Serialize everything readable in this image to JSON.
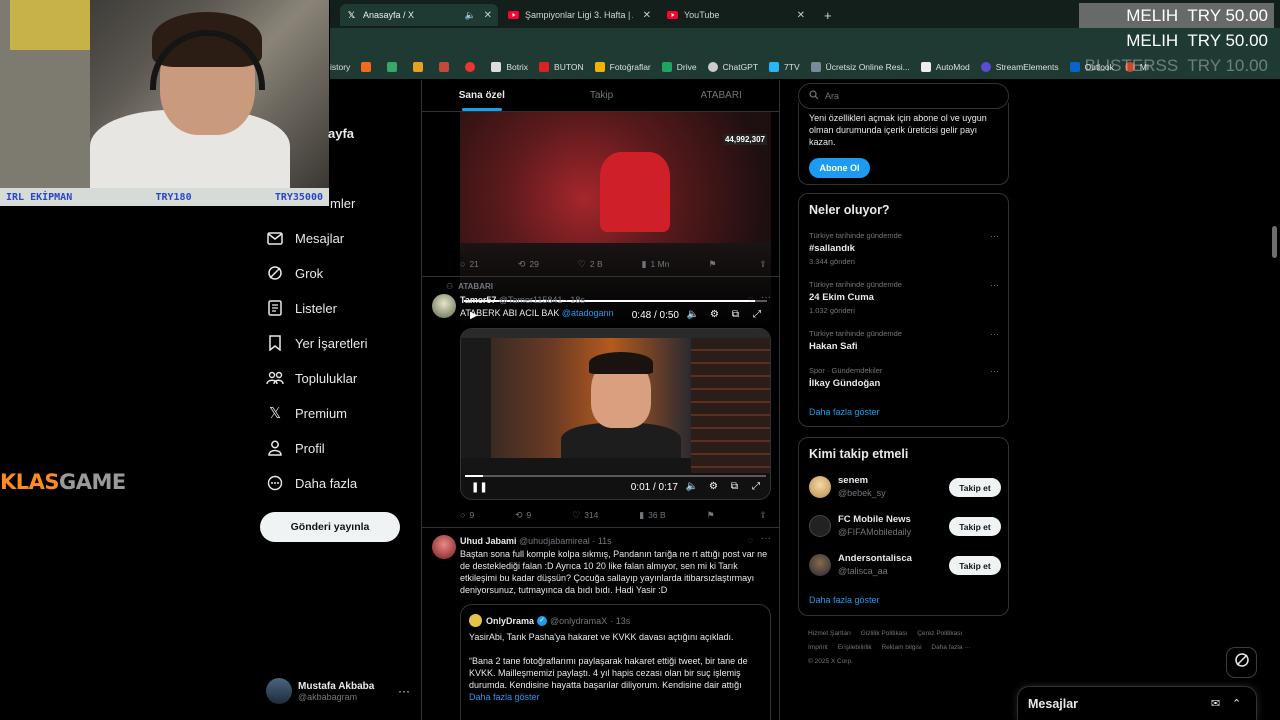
{
  "browser": {
    "tabs": [
      {
        "title": "Anasayfa / X",
        "active": true
      },
      {
        "title": "Şampiyonlar Ligi 3. Hafta | Arse",
        "active": false
      },
      {
        "title": "YouTube",
        "active": false
      }
    ],
    "bookmarks": [
      "istory",
      "",
      "",
      "",
      "",
      "Botrix",
      "BUTON",
      "Fotoğraflar",
      "Drive",
      "ChatGPT",
      "7TV",
      "Ücretsiz Online Resi...",
      "AutoMod",
      "StreamElements",
      "Outlook",
      "Mi"
    ]
  },
  "overlay": {
    "equipment": {
      "label": "IRL EKİPMAN",
      "price1": "TRY180",
      "price2": "TRY35000"
    },
    "donations": [
      {
        "name": "MELIH",
        "amount": "TRY 50.00"
      },
      {
        "name": "MELIH",
        "amount": "TRY 50.00"
      },
      {
        "name": "BLISTERSS",
        "amount": "TRY 10.00"
      }
    ],
    "logo": {
      "part1": "KLAS",
      "part2": "GAME"
    }
  },
  "nav": {
    "title_partial": "ayfa",
    "partial_item": "mler",
    "items": [
      "Mesajlar",
      "Grok",
      "Listeler",
      "Yer İşaretleri",
      "Topluluklar",
      "Premium",
      "Profil",
      "Daha fazla"
    ],
    "post_button": "Gönderi yayınla",
    "account": {
      "name": "Mustafa Akbaba",
      "handle": "@akbabagram"
    }
  },
  "feed": {
    "tabs": [
      "Sana özel",
      "Takip",
      "ATABARI"
    ],
    "video1": {
      "counter": "44,992,307",
      "time": "0:48 / 0:50",
      "progress": 0.96
    },
    "tweet1_actions": {
      "replies": "21",
      "reposts": "29",
      "likes": "2 B",
      "views": "1 Mn"
    },
    "tweet2": {
      "community": "ATABARI",
      "name": "Tamer57",
      "handle": "@Tamer115841",
      "time": "· 18s",
      "text": "ATABERK ABI ACIL BAK",
      "mention": "@atadogann",
      "video_time": "0:01 / 0:17",
      "video_progress": 0.06,
      "actions": {
        "replies": "9",
        "reposts": "9",
        "likes": "314",
        "views": "36 B"
      }
    },
    "tweet3": {
      "name": "Uhud Jabami",
      "handle": "@uhudjabamireal",
      "time": "· 11s",
      "text": "Baştan sona full komple kolpa sıkmış, Pandanın tarığa ne rt attığı post var ne de desteklediği falan :D Ayrıca 10 20 like falan almıyor, sen mi ki Tarık etkileşimi bu kadar düşsün? Çocuğa sallayıp yayınlarda itibarsızlaştırmayı deniyorsunuz, tutmayınca da bıdı bıdı. Hadi Yasir :D",
      "quote": {
        "name": "OnlyDrama",
        "handle": "@onlydramaX",
        "time": "· 13s",
        "line1": "YasirAbi, Tarık Pasha'ya hakaret ve KVKK davası açtığını açıkladı.",
        "line2": "“Bana 2 tane fotoğraflarımı paylaşarak hakaret ettiği tweet, bir tane de KVKK. Mailleşmemizi paylaştı. 4 yıl hapis cezası olan bir suç işlemiş durumda. Kendisine hayatta başarılar diliyorum. Kendisine dair attığı",
        "show_more": "Daha fazla göster"
      }
    }
  },
  "right": {
    "search_placeholder": "Ara",
    "premium": {
      "text": "Yeni özellikleri açmak için abone ol ve uygun olman durumunda içerik üreticisi gelir payı kazan.",
      "button": "Abone Ol"
    },
    "trends": {
      "title": "Neler oluyor?",
      "items": [
        {
          "context": "Türkiye tarihinde gündemde",
          "name": "#sallandık",
          "count": "3.344 gönderi"
        },
        {
          "context": "Türkiye tarihinde gündemde",
          "name": "24 Ekim Cuma",
          "count": "1.032 gönderi"
        },
        {
          "context": "Türkiye tarihinde gündemde",
          "name": "Hakan Safi",
          "count": ""
        },
        {
          "context": "Spor · Gündemdekiler",
          "name": "İlkay Gündoğan",
          "count": ""
        }
      ],
      "show_more": "Daha fazla göster"
    },
    "who_to_follow": {
      "title": "Kimi takip etmeli",
      "items": [
        {
          "name": "senem",
          "handle": "@bebek_sy",
          "button": "Takip et"
        },
        {
          "name": "FC Mobile News",
          "handle": "@FIFAMobiledaily",
          "button": "Takip et"
        },
        {
          "name": "Andersontalisca",
          "handle": "@talisca_aa",
          "button": "Takip et"
        }
      ],
      "show_more": "Daha fazla göster"
    },
    "footer": [
      "Hizmet Şartları",
      "Gizlilik Politikası",
      "Çerez Politikası",
      "Imprint",
      "Erişilebilirlik",
      "Reklam bilgisi",
      "Daha fazla ···",
      "© 2025 X Corp."
    ]
  },
  "messages_drawer": {
    "title": "Mesajlar"
  }
}
